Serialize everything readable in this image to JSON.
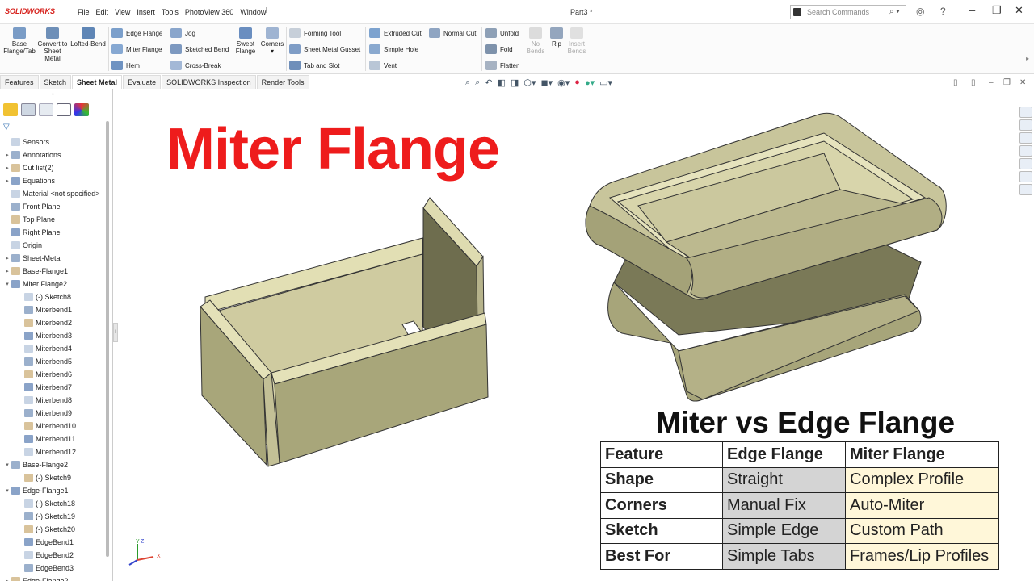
{
  "app": {
    "logo_text": "SOLIDWORKS",
    "doc_title": "Part3 *"
  },
  "menu": [
    "File",
    "Edit",
    "View",
    "Insert",
    "Tools",
    "PhotoView 360",
    "Window"
  ],
  "search": {
    "placeholder": "Search Commands"
  },
  "ribbon": {
    "base_flange": "Base Flange/Tab",
    "convert": "Convert to Sheet Metal",
    "lofted": "Lofted-Bend",
    "edge_flange": "Edge Flange",
    "miter_flange": "Miter Flange",
    "hem": "Hem",
    "jog": "Jog",
    "sketched_bend": "Sketched Bend",
    "cross_break": "Cross-Break",
    "swept_flange": "Swept Flange",
    "corners": "Corners",
    "forming_tool": "Forming Tool",
    "sheet_metal_gusset": "Sheet Metal Gusset",
    "tab_and_slot": "Tab and Slot",
    "extruded_cut": "Extruded Cut",
    "simple_hole": "Simple Hole",
    "vent": "Vent",
    "normal_cut": "Normal Cut",
    "unfold": "Unfold",
    "fold": "Fold",
    "flatten": "Flatten",
    "no_bends": "No Bends",
    "rip": "Rip",
    "insert_bends": "Insert Bends"
  },
  "tabs": [
    "Features",
    "Sketch",
    "Sheet Metal",
    "Evaluate",
    "SOLIDWORKS Inspection",
    "Render Tools"
  ],
  "tree": [
    {
      "label": "Sensors",
      "indent": 0,
      "arrow": ""
    },
    {
      "label": "Annotations",
      "indent": 0,
      "arrow": "▸"
    },
    {
      "label": "Cut list(2)",
      "indent": 0,
      "arrow": "▸"
    },
    {
      "label": "Equations",
      "indent": 0,
      "arrow": "▸"
    },
    {
      "label": "Material <not specified>",
      "indent": 0,
      "arrow": ""
    },
    {
      "label": "Front Plane",
      "indent": 0,
      "arrow": ""
    },
    {
      "label": "Top Plane",
      "indent": 0,
      "arrow": ""
    },
    {
      "label": "Right Plane",
      "indent": 0,
      "arrow": ""
    },
    {
      "label": "Origin",
      "indent": 0,
      "arrow": ""
    },
    {
      "label": "Sheet-Metal",
      "indent": 0,
      "arrow": "▸"
    },
    {
      "label": "Base-Flange1",
      "indent": 0,
      "arrow": "▸"
    },
    {
      "label": "Miter Flange2",
      "indent": 0,
      "arrow": "▾"
    },
    {
      "label": "(-) Sketch8",
      "indent": 1,
      "arrow": ""
    },
    {
      "label": "Miterbend1",
      "indent": 1,
      "arrow": ""
    },
    {
      "label": "Miterbend2",
      "indent": 1,
      "arrow": ""
    },
    {
      "label": "Miterbend3",
      "indent": 1,
      "arrow": ""
    },
    {
      "label": "Miterbend4",
      "indent": 1,
      "arrow": ""
    },
    {
      "label": "Miterbend5",
      "indent": 1,
      "arrow": ""
    },
    {
      "label": "Miterbend6",
      "indent": 1,
      "arrow": ""
    },
    {
      "label": "Miterbend7",
      "indent": 1,
      "arrow": ""
    },
    {
      "label": "Miterbend8",
      "indent": 1,
      "arrow": ""
    },
    {
      "label": "Miterbend9",
      "indent": 1,
      "arrow": ""
    },
    {
      "label": "Miterbend10",
      "indent": 1,
      "arrow": ""
    },
    {
      "label": "Miterbend11",
      "indent": 1,
      "arrow": ""
    },
    {
      "label": "Miterbend12",
      "indent": 1,
      "arrow": ""
    },
    {
      "label": "Base-Flange2",
      "indent": 0,
      "arrow": "▾"
    },
    {
      "label": "(-) Sketch9",
      "indent": 1,
      "arrow": ""
    },
    {
      "label": "Edge-Flange1",
      "indent": 0,
      "arrow": "▾"
    },
    {
      "label": "(-) Sketch18",
      "indent": 1,
      "arrow": ""
    },
    {
      "label": "(-) Sketch19",
      "indent": 1,
      "arrow": ""
    },
    {
      "label": "(-) Sketch20",
      "indent": 1,
      "arrow": ""
    },
    {
      "label": "EdgeBend1",
      "indent": 1,
      "arrow": ""
    },
    {
      "label": "EdgeBend2",
      "indent": 1,
      "arrow": ""
    },
    {
      "label": "EdgeBend3",
      "indent": 1,
      "arrow": ""
    },
    {
      "label": "Edge-Flange2",
      "indent": 0,
      "arrow": "▸"
    }
  ],
  "viewport": {
    "headline": "Miter Flange",
    "subheadline": "Miter vs Edge Flange",
    "table": {
      "header": [
        "Feature",
        "Edge Flange",
        "Miter Flange"
      ],
      "rows": [
        [
          "Shape",
          "Straight",
          "Complex Profile"
        ],
        [
          "Corners",
          "Manual Fix",
          "Auto-Miter"
        ],
        [
          "Sketch",
          "Simple Edge",
          "Custom Path"
        ],
        [
          "Best For",
          "Simple Tabs",
          "Frames/Lip Profiles"
        ]
      ]
    },
    "triad": {
      "x": "X",
      "y": "Y",
      "z": "Z"
    }
  },
  "colors": {
    "brand": "#d6211c",
    "headline": "#ee1c1c",
    "model_face": "#a8a67a",
    "model_light": "#e4e1b8",
    "model_dark": "#6b6a4a"
  }
}
